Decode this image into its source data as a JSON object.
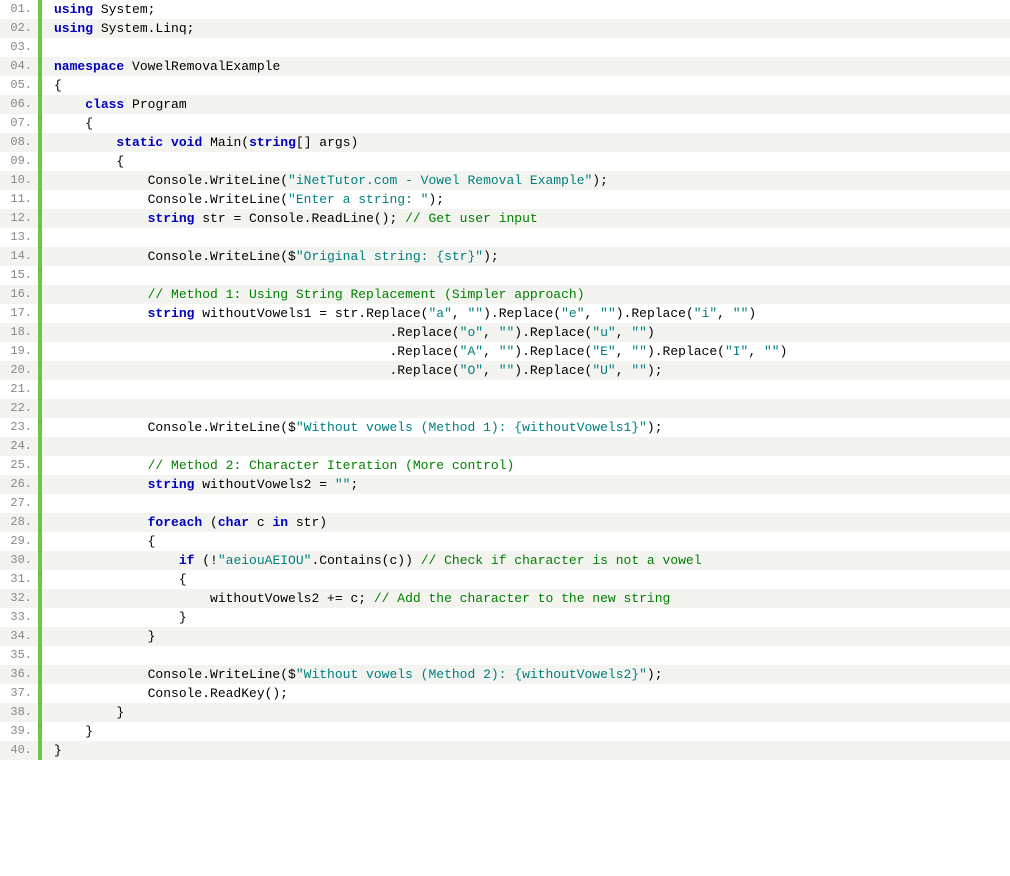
{
  "lines": [
    {
      "n": "01.",
      "tokens": [
        [
          "kw",
          "using"
        ],
        [
          "txt",
          " System;"
        ]
      ]
    },
    {
      "n": "02.",
      "tokens": [
        [
          "kw",
          "using"
        ],
        [
          "txt",
          " System.Linq;"
        ]
      ]
    },
    {
      "n": "03.",
      "tokens": []
    },
    {
      "n": "04.",
      "tokens": [
        [
          "kw",
          "namespace"
        ],
        [
          "txt",
          " VowelRemovalExample"
        ]
      ]
    },
    {
      "n": "05.",
      "tokens": [
        [
          "txt",
          "{"
        ]
      ]
    },
    {
      "n": "06.",
      "tokens": [
        [
          "txt",
          "    "
        ],
        [
          "kw",
          "class"
        ],
        [
          "txt",
          " Program"
        ]
      ]
    },
    {
      "n": "07.",
      "tokens": [
        [
          "txt",
          "    {"
        ]
      ]
    },
    {
      "n": "08.",
      "tokens": [
        [
          "txt",
          "        "
        ],
        [
          "kw",
          "static"
        ],
        [
          "txt",
          " "
        ],
        [
          "kw",
          "void"
        ],
        [
          "txt",
          " Main("
        ],
        [
          "kw",
          "string"
        ],
        [
          "txt",
          "[] args)"
        ]
      ]
    },
    {
      "n": "09.",
      "tokens": [
        [
          "txt",
          "        {"
        ]
      ]
    },
    {
      "n": "10.",
      "tokens": [
        [
          "txt",
          "            Console.WriteLine("
        ],
        [
          "str",
          "\"iNetTutor.com - Vowel Removal Example\""
        ],
        [
          "txt",
          ");"
        ]
      ]
    },
    {
      "n": "11.",
      "tokens": [
        [
          "txt",
          "            Console.WriteLine("
        ],
        [
          "str",
          "\"Enter a string: \""
        ],
        [
          "txt",
          ");"
        ]
      ]
    },
    {
      "n": "12.",
      "tokens": [
        [
          "txt",
          "            "
        ],
        [
          "kw",
          "string"
        ],
        [
          "txt",
          " str = Console.ReadLine(); "
        ],
        [
          "cmt",
          "// Get user input"
        ]
      ]
    },
    {
      "n": "13.",
      "tokens": []
    },
    {
      "n": "14.",
      "tokens": [
        [
          "txt",
          "            Console.WriteLine($"
        ],
        [
          "str",
          "\"Original string: {str}\""
        ],
        [
          "txt",
          ");"
        ]
      ]
    },
    {
      "n": "15.",
      "tokens": []
    },
    {
      "n": "16.",
      "tokens": [
        [
          "txt",
          "            "
        ],
        [
          "cmt",
          "// Method 1: Using String Replacement (Simpler approach)"
        ]
      ]
    },
    {
      "n": "17.",
      "tokens": [
        [
          "txt",
          "            "
        ],
        [
          "kw",
          "string"
        ],
        [
          "txt",
          " withoutVowels1 = str.Replace("
        ],
        [
          "str",
          "\"a\""
        ],
        [
          "txt",
          ", "
        ],
        [
          "str",
          "\"\""
        ],
        [
          "txt",
          ").Replace("
        ],
        [
          "str",
          "\"e\""
        ],
        [
          "txt",
          ", "
        ],
        [
          "str",
          "\"\""
        ],
        [
          "txt",
          ").Replace("
        ],
        [
          "str",
          "\"i\""
        ],
        [
          "txt",
          ", "
        ],
        [
          "str",
          "\"\""
        ],
        [
          "txt",
          ")"
        ]
      ]
    },
    {
      "n": "18.",
      "tokens": [
        [
          "txt",
          "                                           .Replace("
        ],
        [
          "str",
          "\"o\""
        ],
        [
          "txt",
          ", "
        ],
        [
          "str",
          "\"\""
        ],
        [
          "txt",
          ").Replace("
        ],
        [
          "str",
          "\"u\""
        ],
        [
          "txt",
          ", "
        ],
        [
          "str",
          "\"\""
        ],
        [
          "txt",
          ")"
        ]
      ]
    },
    {
      "n": "19.",
      "tokens": [
        [
          "txt",
          "                                           .Replace("
        ],
        [
          "str",
          "\"A\""
        ],
        [
          "txt",
          ", "
        ],
        [
          "str",
          "\"\""
        ],
        [
          "txt",
          ").Replace("
        ],
        [
          "str",
          "\"E\""
        ],
        [
          "txt",
          ", "
        ],
        [
          "str",
          "\"\""
        ],
        [
          "txt",
          ").Replace("
        ],
        [
          "str",
          "\"I\""
        ],
        [
          "txt",
          ", "
        ],
        [
          "str",
          "\"\""
        ],
        [
          "txt",
          ")"
        ]
      ]
    },
    {
      "n": "20.",
      "tokens": [
        [
          "txt",
          "                                           .Replace("
        ],
        [
          "str",
          "\"O\""
        ],
        [
          "txt",
          ", "
        ],
        [
          "str",
          "\"\""
        ],
        [
          "txt",
          ").Replace("
        ],
        [
          "str",
          "\"U\""
        ],
        [
          "txt",
          ", "
        ],
        [
          "str",
          "\"\""
        ],
        [
          "txt",
          ");"
        ]
      ]
    },
    {
      "n": "21.",
      "tokens": []
    },
    {
      "n": "22.",
      "tokens": []
    },
    {
      "n": "23.",
      "tokens": [
        [
          "txt",
          "            Console.WriteLine($"
        ],
        [
          "str",
          "\"Without vowels (Method 1): {withoutVowels1}\""
        ],
        [
          "txt",
          ");"
        ]
      ]
    },
    {
      "n": "24.",
      "tokens": []
    },
    {
      "n": "25.",
      "tokens": [
        [
          "txt",
          "            "
        ],
        [
          "cmt",
          "// Method 2: Character Iteration (More control)"
        ]
      ]
    },
    {
      "n": "26.",
      "tokens": [
        [
          "txt",
          "            "
        ],
        [
          "kw",
          "string"
        ],
        [
          "txt",
          " withoutVowels2 = "
        ],
        [
          "str",
          "\"\""
        ],
        [
          "txt",
          ";"
        ]
      ]
    },
    {
      "n": "27.",
      "tokens": []
    },
    {
      "n": "28.",
      "tokens": [
        [
          "txt",
          "            "
        ],
        [
          "kw",
          "foreach"
        ],
        [
          "txt",
          " ("
        ],
        [
          "kw",
          "char"
        ],
        [
          "txt",
          " c "
        ],
        [
          "kw",
          "in"
        ],
        [
          "txt",
          " str)"
        ]
      ]
    },
    {
      "n": "29.",
      "tokens": [
        [
          "txt",
          "            {"
        ]
      ]
    },
    {
      "n": "30.",
      "tokens": [
        [
          "txt",
          "                "
        ],
        [
          "kw",
          "if"
        ],
        [
          "txt",
          " (!"
        ],
        [
          "str",
          "\"aeiouAEIOU\""
        ],
        [
          "txt",
          ".Contains(c)) "
        ],
        [
          "cmt",
          "// Check if character is not a vowel"
        ]
      ]
    },
    {
      "n": "31.",
      "tokens": [
        [
          "txt",
          "                {"
        ]
      ]
    },
    {
      "n": "32.",
      "tokens": [
        [
          "txt",
          "                    withoutVowels2 += c; "
        ],
        [
          "cmt",
          "// Add the character to the new string"
        ]
      ]
    },
    {
      "n": "33.",
      "tokens": [
        [
          "txt",
          "                }"
        ]
      ]
    },
    {
      "n": "34.",
      "tokens": [
        [
          "txt",
          "            }"
        ]
      ]
    },
    {
      "n": "35.",
      "tokens": []
    },
    {
      "n": "36.",
      "tokens": [
        [
          "txt",
          "            Console.WriteLine($"
        ],
        [
          "str",
          "\"Without vowels (Method 2): {withoutVowels2}\""
        ],
        [
          "txt",
          ");"
        ]
      ]
    },
    {
      "n": "37.",
      "tokens": [
        [
          "txt",
          "            Console.ReadKey();"
        ]
      ]
    },
    {
      "n": "38.",
      "tokens": [
        [
          "txt",
          "        }"
        ]
      ]
    },
    {
      "n": "39.",
      "tokens": [
        [
          "txt",
          "    }"
        ]
      ]
    },
    {
      "n": "40.",
      "tokens": [
        [
          "txt",
          "}"
        ]
      ]
    }
  ]
}
